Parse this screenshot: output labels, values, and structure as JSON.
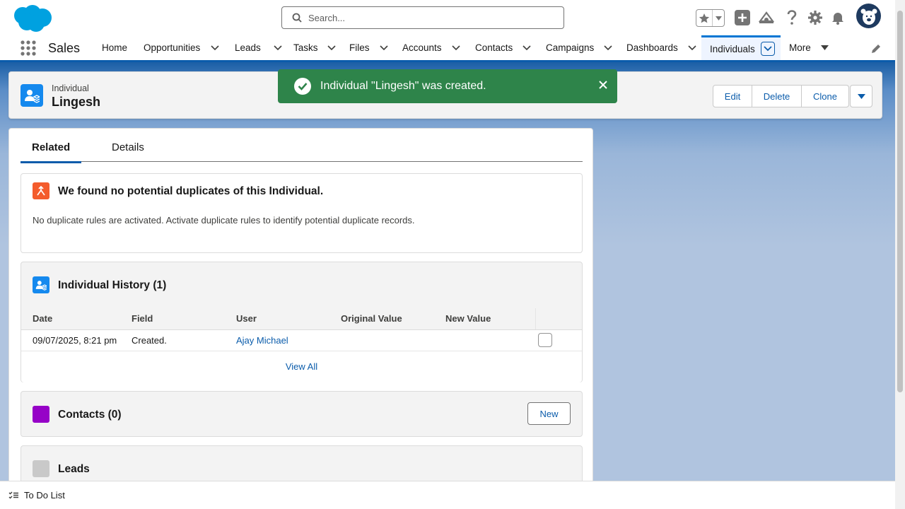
{
  "search": {
    "placeholder": "Search..."
  },
  "app": {
    "name": "Sales"
  },
  "nav": {
    "items": [
      {
        "label": "Home"
      },
      {
        "label": "Opportunities"
      },
      {
        "label": "Leads"
      },
      {
        "label": "Tasks"
      },
      {
        "label": "Files"
      },
      {
        "label": "Accounts"
      },
      {
        "label": "Contacts"
      },
      {
        "label": "Campaigns"
      },
      {
        "label": "Dashboards"
      },
      {
        "label": "Individuals"
      },
      {
        "label": "More"
      }
    ]
  },
  "record": {
    "type": "Individual",
    "name": "Lingesh"
  },
  "actions": {
    "edit": "Edit",
    "delete": "Delete",
    "clone": "Clone"
  },
  "toast": {
    "message": "Individual \"Lingesh\" was created."
  },
  "tabs": {
    "related": "Related",
    "details": "Details"
  },
  "duplicates": {
    "title": "We found no potential duplicates of this Individual.",
    "body": "No duplicate rules are activated. Activate duplicate rules to identify potential duplicate records."
  },
  "history": {
    "title": "Individual History (1)",
    "columns": [
      "Date",
      "Field",
      "User",
      "Original Value",
      "New Value"
    ],
    "rows": [
      {
        "date": "09/07/2025, 8:21 pm",
        "field": "Created.",
        "user": "Ajay Michael",
        "original": "",
        "new": ""
      }
    ],
    "view_all": "View All"
  },
  "contacts": {
    "title": "Contacts (0)",
    "new_label": "New"
  },
  "leads": {
    "title": "Leads"
  },
  "footer": {
    "todo": "To Do List"
  },
  "colors": {
    "brand": "#0176d3",
    "toast": "#2e844a",
    "individual_icon": "#1589ee",
    "duplicate_icon": "#f45c2c",
    "contacts_icon": "#9602c7",
    "leads_icon": "#c9c9c9"
  }
}
